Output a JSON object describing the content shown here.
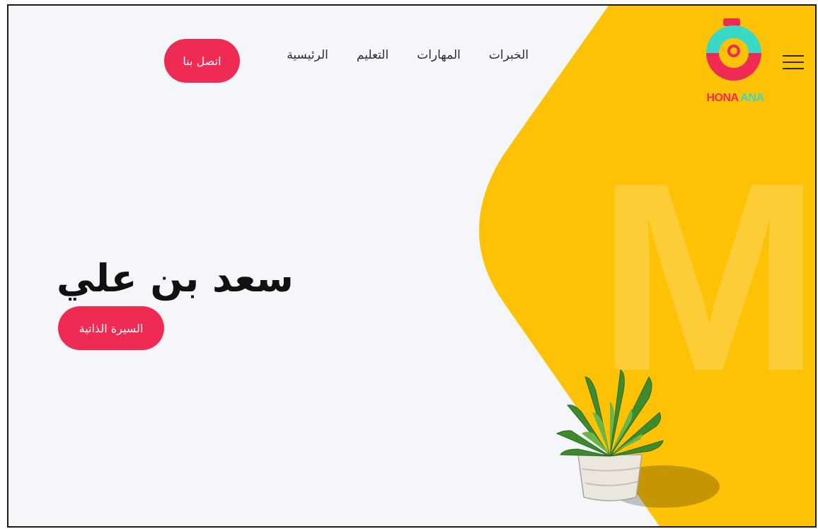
{
  "logo": {
    "word1": "HONA",
    "word2": "ANA"
  },
  "nav": {
    "items": [
      {
        "label": "الرئيسية"
      },
      {
        "label": "التعليم"
      },
      {
        "label": "المهارات"
      },
      {
        "label": "الخبرات"
      }
    ],
    "contact_label": "اتصل بنا"
  },
  "hero": {
    "name": "سعد بن علي",
    "cv_button_label": "السيرة الذاتية",
    "watermark_letter": "M"
  },
  "colors": {
    "accent": "#f02b53",
    "yellow": "#fdc106",
    "teal": "#39d9c6",
    "page_bg": "#f4f6f9"
  }
}
